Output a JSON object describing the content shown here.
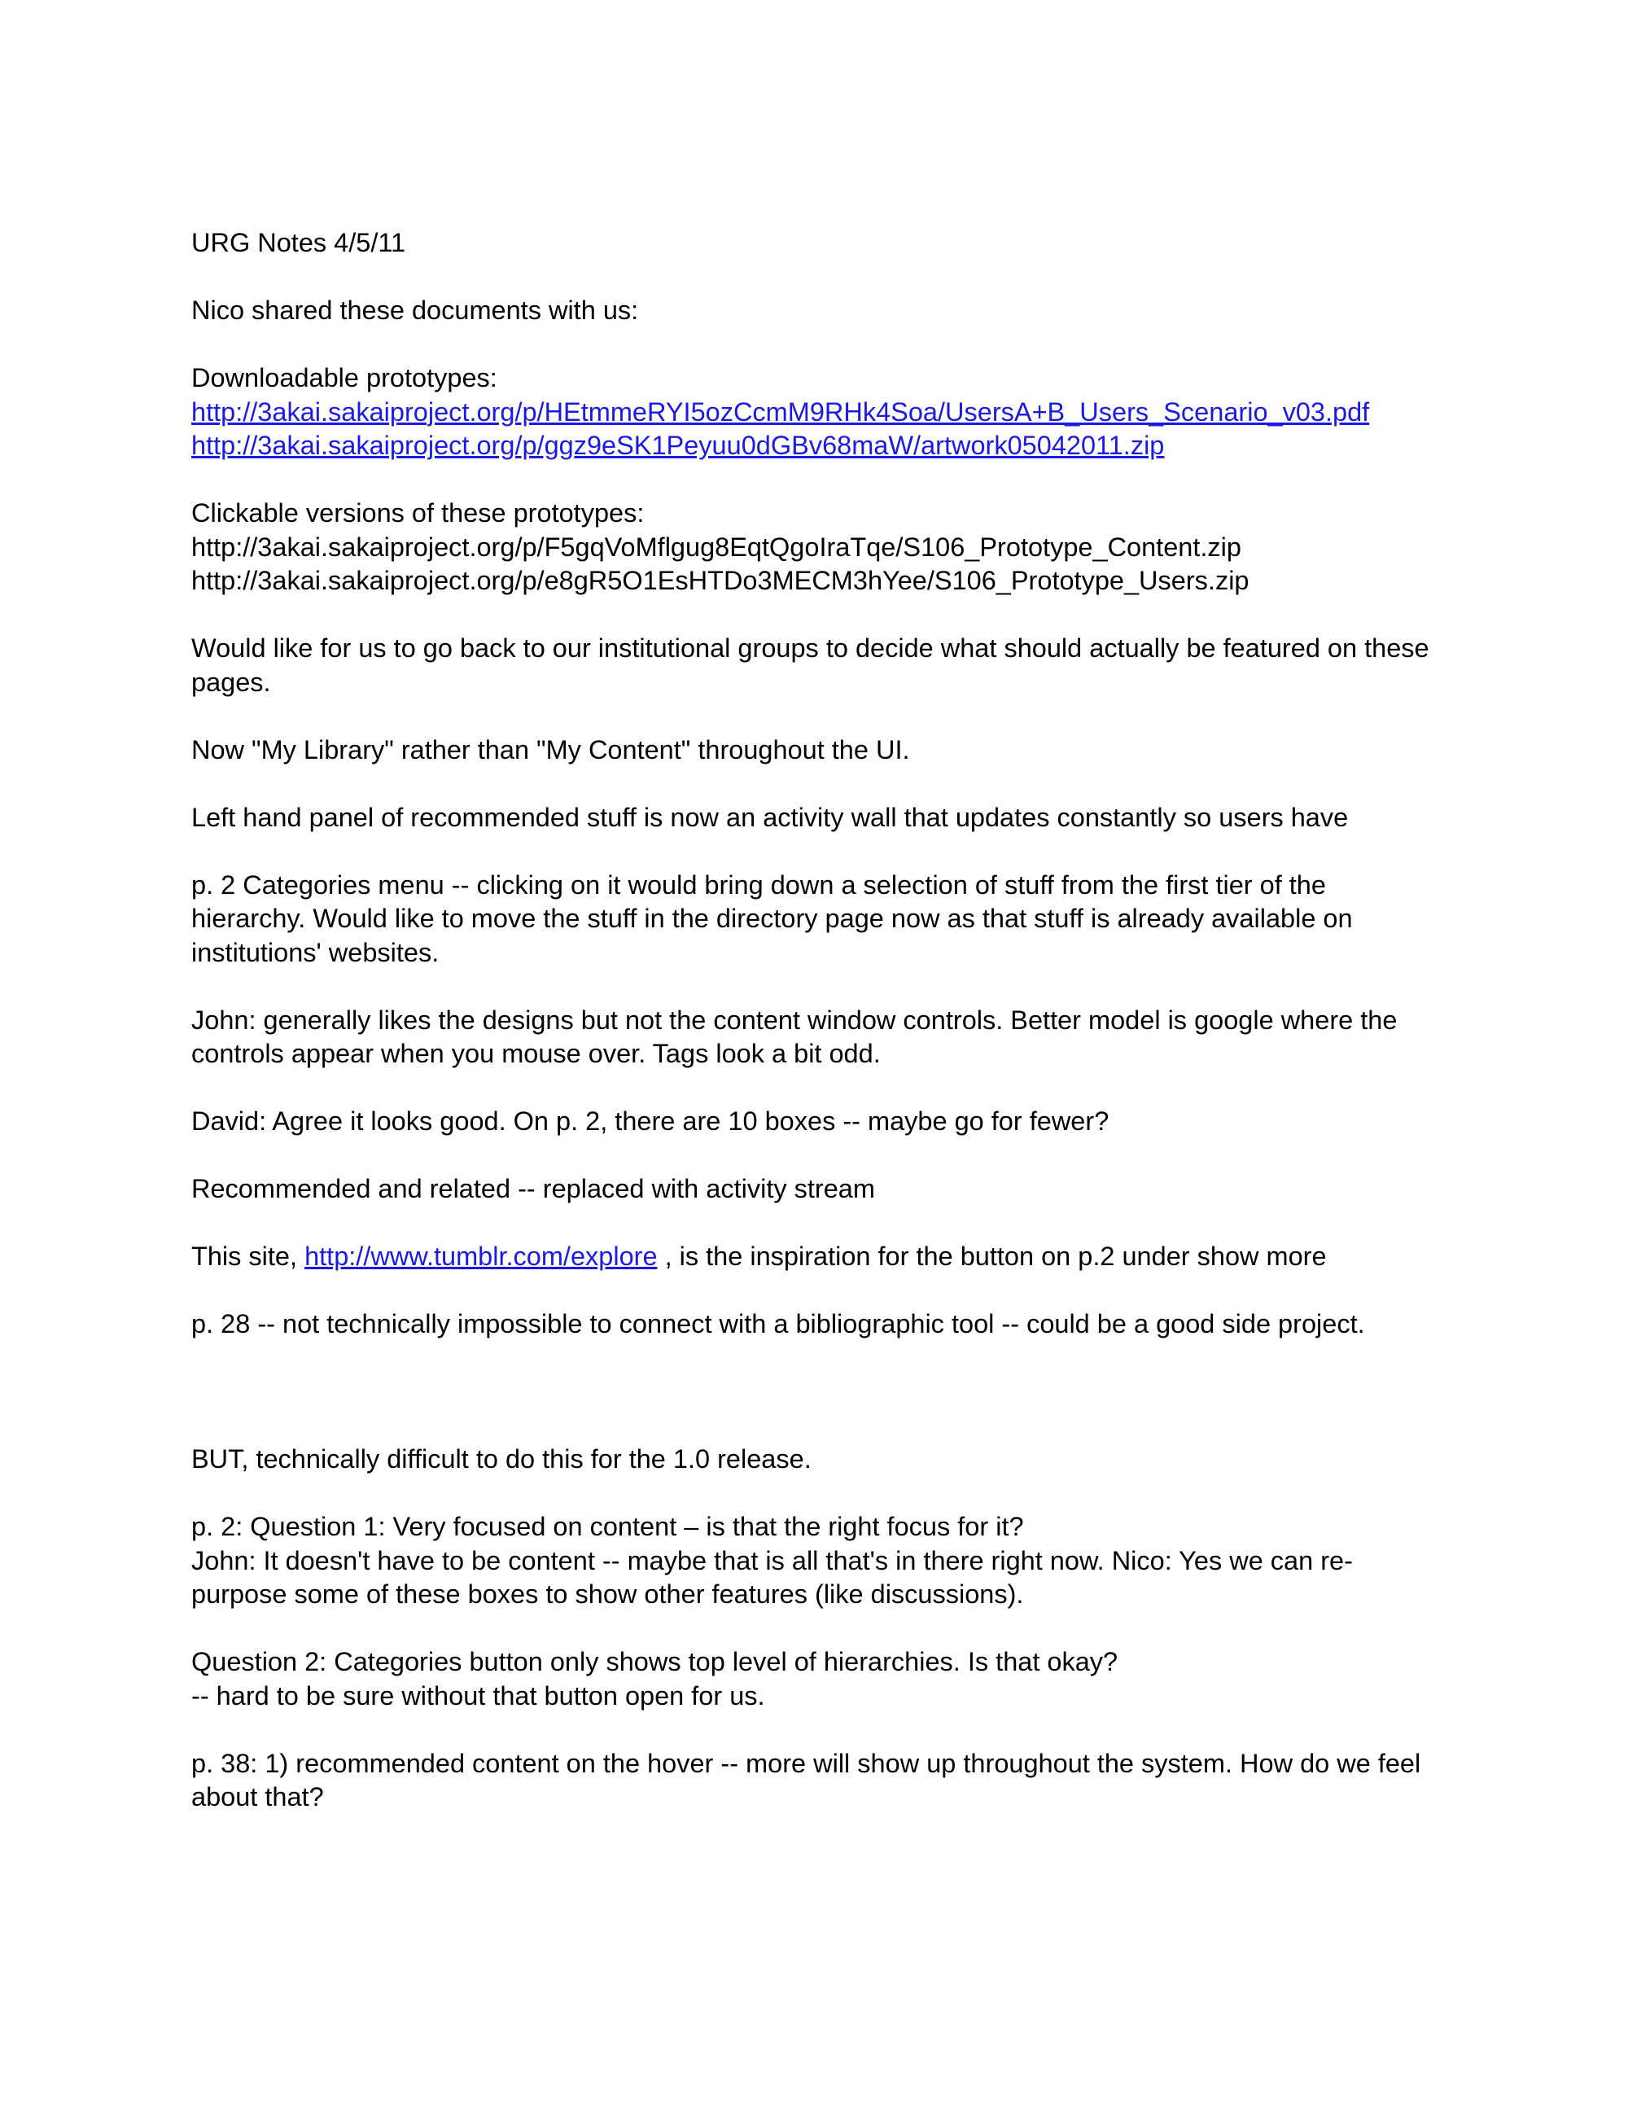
{
  "title": "URG Notes 4/5/11",
  "intro": "Nico shared these documents with us:",
  "downloadable": {
    "heading": "Downloadable prototypes:",
    "links": [
      "http://3akai.sakaiproject.org/p/HEtmmeRYI5ozCcmM9RHk4Soa/UsersA+B_Users_Scenario_v03.pdf",
      "http://3akai.sakaiproject.org/p/ggz9eSK1Peyuu0dGBv68maW/artwork05042011.zip"
    ]
  },
  "clickable": {
    "heading": "Clickable versions of these prototypes:",
    "urls": [
      "http://3akai.sakaiproject.org/p/F5gqVoMflgug8EqtQgoIraTqe/S106_Prototype_Content.zip",
      "http://3akai.sakaiproject.org/p/e8gR5O1EsHTDo3MECM3hYee/S106_Prototype_Users.zip"
    ]
  },
  "p_institutional": [
    "Would like for us to go back to our institutional groups to decide what should actually be featured on these",
    "pages."
  ],
  "p_library": "Now \"My Library\" rather than \"My Content\" throughout the UI.",
  "p_leftpanel": "Left hand panel of recommended stuff is now an activity wall that updates constantly so users have",
  "p_categories": [
    "p. 2 Categories menu -- clicking on it would bring down a selection of stuff from the first tier of the",
    "hierarchy. Would like to move the stuff in the directory page now as that stuff is already available on",
    "institutions' websites."
  ],
  "p_john": [
    "John: generally likes the designs but not the content window controls. Better model is google where the",
    "controls appear when you mouse over. Tags look a bit odd."
  ],
  "p_david": "David: Agree it looks good. On p. 2, there are 10 boxes -- maybe go for fewer?",
  "p_recommended": "Recommended and related -- replaced with activity stream",
  "p_site": {
    "before": "This site, ",
    "link": "http://www.tumblr.com/explore",
    "after": " , is the inspiration for the button on p.2 under show more"
  },
  "p_p28": "p. 28 -- not technically impossible to connect with a bibliographic tool -- could be a good side project.",
  "p_but": "BUT, technically difficult to do this for the 1.0 release.",
  "p_q1": [
    "p. 2: Question 1:  Very focused on content – is that the right focus for it?",
    "John: It doesn't have to be content -- maybe that is all that's in there right now. Nico: Yes we can re-",
    "purpose some of these boxes to show other features (like discussions)."
  ],
  "p_q2": [
    "Question 2: Categories button only shows top level of hierarchies. Is that okay?",
    "-- hard to be sure without that button open for us."
  ],
  "p_p38": [
    "p. 38: 1) recommended content on the hover -- more will show up throughout the system. How do we feel",
    "about that?"
  ],
  "colors": {
    "text": "#000000",
    "link": "#1a1ae6",
    "background": "#ffffff"
  }
}
